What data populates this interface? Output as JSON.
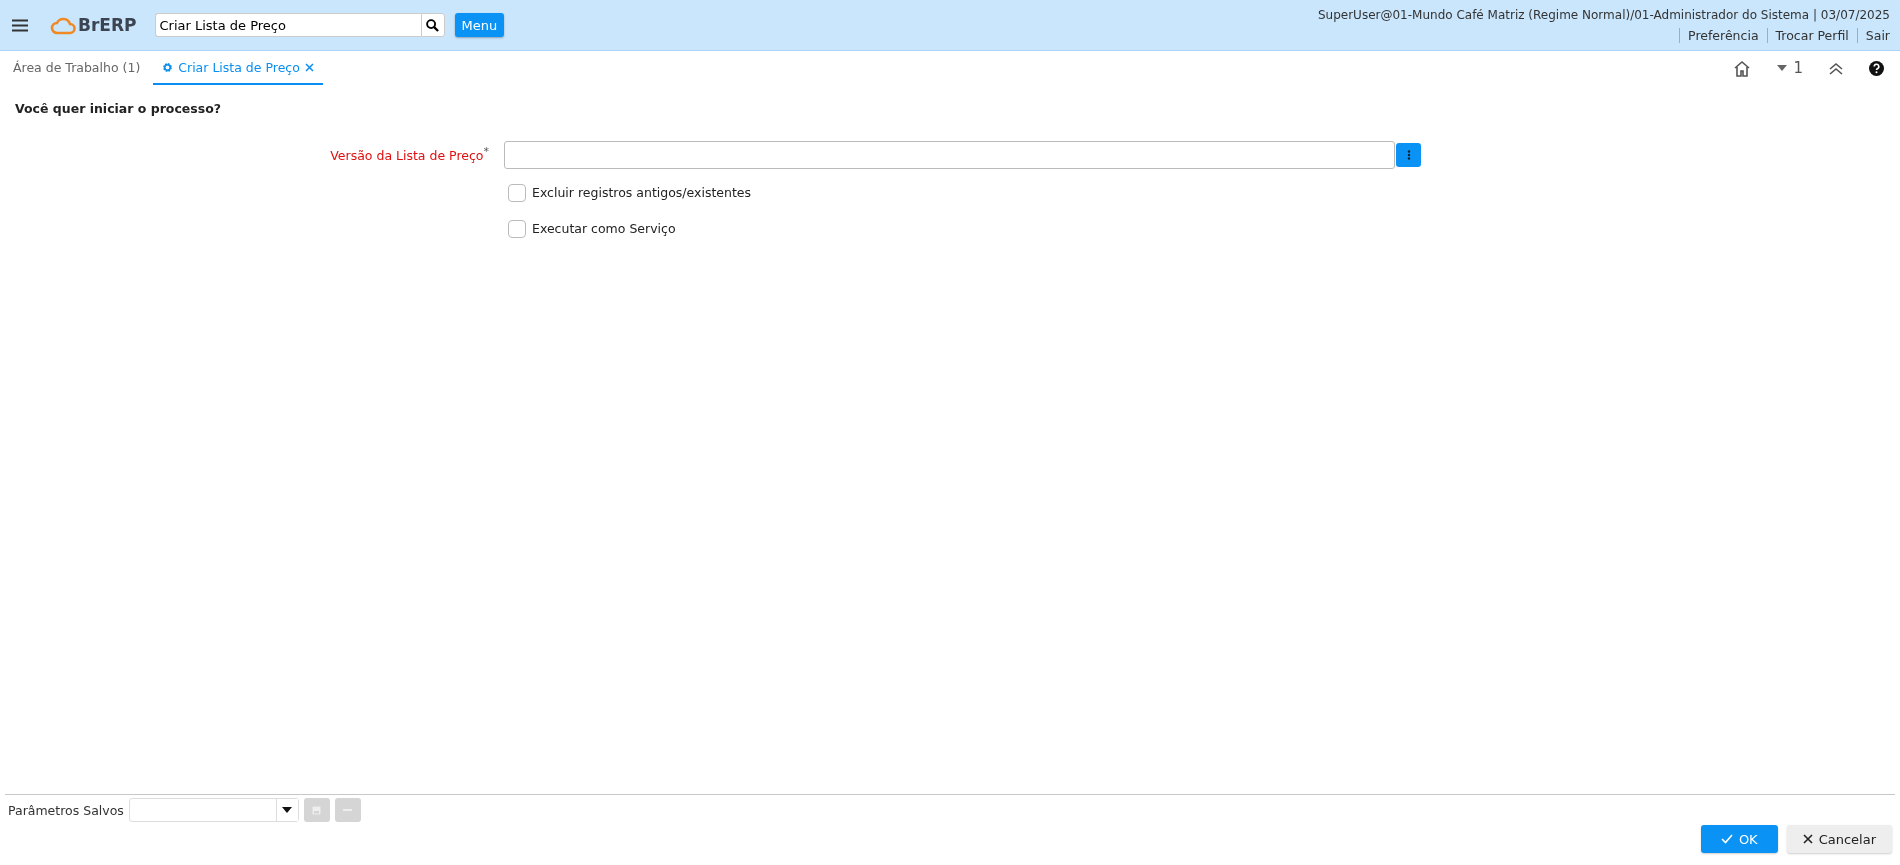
{
  "header": {
    "logo": "BrERP",
    "search": {
      "value": "Criar Lista de Preço"
    },
    "menu_button": "Menu",
    "user_info": "SuperUser@01-Mundo Café Matriz (Regime Normal)/01-Administrador do Sistema | 03/07/2025",
    "links": [
      "Preferência",
      "Trocar Perfil",
      "Sair"
    ]
  },
  "tabs": [
    {
      "label": "Área de Trabalho (1)",
      "selected": false,
      "closable": false,
      "kind": "plain"
    },
    {
      "label": "Criar Lista de Preço",
      "selected": true,
      "closable": true,
      "kind": "process"
    }
  ],
  "tab_tools": {
    "window_count": "1"
  },
  "form": {
    "question": "Você quer iniciar o processo?",
    "fields": [
      {
        "kind": "lookup",
        "label": "Versão da Lista de Preço",
        "required": true,
        "required_mark": "*"
      },
      {
        "kind": "checkbox",
        "label": "Excluir registros antigos/existentes",
        "checked": false
      },
      {
        "kind": "checkbox",
        "label": "Executar como Serviço",
        "checked": false
      }
    ]
  },
  "footer": {
    "saved_params_label": "Parâmetros Salvos",
    "buttons": [
      {
        "label": "OK",
        "kind": "primary"
      },
      {
        "label": "Cancelar",
        "kind": "secondary"
      }
    ]
  }
}
